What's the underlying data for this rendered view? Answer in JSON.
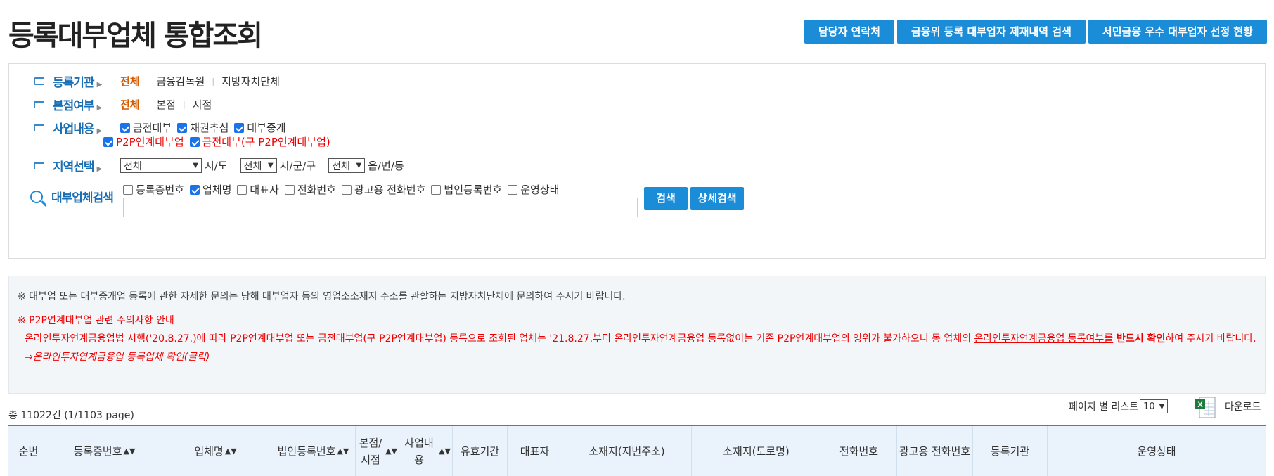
{
  "page_title": "등록대부업체 통합조회",
  "top_buttons": [
    "담당자 연락처",
    "금융위 등록 대부업자 제재내역 검색",
    "서민금융 우수 대부업자 선정 현황"
  ],
  "filters": {
    "agency": {
      "label": "등록기관",
      "options": [
        "전체",
        "금융감독원",
        "지방자치단체"
      ]
    },
    "branch": {
      "label": "본점여부",
      "options": [
        "전체",
        "본점",
        "지점"
      ]
    },
    "business": {
      "label": "사업내용",
      "checks": [
        "금전대부",
        "채권추심",
        "대부중개",
        "P2P연계대부업",
        "금전대부(구 P2P연계대부업)"
      ]
    },
    "region": {
      "label": "지역선택",
      "sido_value": "전체",
      "sido_unit": "시/도",
      "sigungu_value": "전체",
      "sigungu_unit": "시/군/구",
      "dong_value": "전체",
      "dong_unit": "읍/면/동"
    }
  },
  "search": {
    "label": "대부업체검색",
    "options": [
      "등록증번호",
      "업체명",
      "대표자",
      "전화번호",
      "광고용 전화번호",
      "법인등록번호",
      "운영상태"
    ],
    "selected": "업체명",
    "input_value": "",
    "search_button": "검색",
    "detail_button": "상세검색"
  },
  "notice": {
    "line1": "※ 대부업 또는 대부중개업 등록에 관한 자세한 문의는 당해 대부업자 등의 영업소소재지 주소를 관할하는 지방자치단체에 문의하여 주시기 바랍니다.",
    "p2p_title": "※ P2P연계대부업 관련 주의사항 안내",
    "p2p_body_a": "온라인투자연계금융업법 시행('20.8.27.)에 따라 P2P연계대부업 또는 금전대부업(구 P2P연계대부업) 등록으로 조회된 업체는 '21.8.27.부터 온라인투자연계금융업 등록없이는 기존 P2P연계대부업의 영위가 불가하오니 동 업체의 ",
    "p2p_body_u": "온라인투자연계금융업 등록여부를",
    "p2p_body_b": " 반드시 확인",
    "p2p_body_c": "하여 주시기 바랍니다.",
    "p2p_link": "⇒온라인투자연계금융업 등록업체 확인(클릭)"
  },
  "results": {
    "total_text": "총 11022건 (1/1103 page)",
    "per_page_label": "페이지 별 리스트",
    "per_page_value": "10",
    "download_label": "다운로드"
  },
  "table_headers": [
    "순번",
    "등록증번호",
    "업체명",
    "법인등록번호",
    "본점/지점",
    "사업내용",
    "유효기간",
    "대표자",
    "소재지(지번주소)",
    "소재지(도로명)",
    "전화번호",
    "광고용 전화번호",
    "등록기관",
    "운영상태"
  ],
  "colors": {
    "accent": "#1a8cd8",
    "active": "#d45b00",
    "alert": "#e00000"
  }
}
